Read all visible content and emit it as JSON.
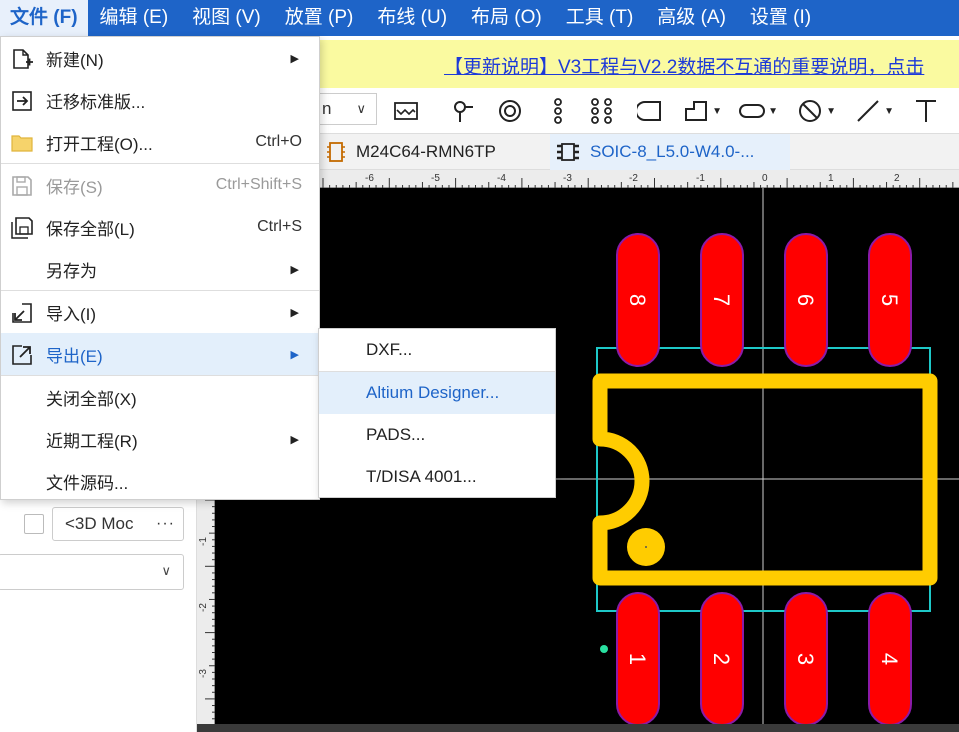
{
  "menubar": {
    "items": [
      {
        "label": "文件 (F)",
        "active": true
      },
      {
        "label": "编辑 (E)"
      },
      {
        "label": "视图 (V)"
      },
      {
        "label": "放置 (P)"
      },
      {
        "label": "布线 (U)"
      },
      {
        "label": "布局 (O)"
      },
      {
        "label": "工具 (T)"
      },
      {
        "label": "高级 (A)"
      },
      {
        "label": "设置 (I)"
      }
    ]
  },
  "notice": {
    "text": "【更新说明】V3工程与V2.2数据不互通的重要说明，点击"
  },
  "toolbar": {
    "unit_select": "n"
  },
  "tabs": [
    {
      "label": "M24C64-RMN6TP",
      "icon": "chip-icon"
    },
    {
      "label": "SOIC-8_L5.0-W4.0-...",
      "icon": "footprint-icon",
      "active": true
    }
  ],
  "file_menu": {
    "items": [
      {
        "label": "新建(N)",
        "icon": "new-file-icon",
        "submenu": true
      },
      {
        "label": "迁移标准版...",
        "icon": "migrate-icon"
      },
      {
        "label": "打开工程(O)...",
        "icon": "folder-icon",
        "shortcut": "Ctrl+O"
      },
      {
        "label": "保存(S)",
        "icon": "save-icon",
        "shortcut": "Ctrl+Shift+S",
        "disabled": true
      },
      {
        "label": "保存全部(L)",
        "icon": "save-all-icon",
        "shortcut": "Ctrl+S"
      },
      {
        "label": "另存为",
        "submenu": true
      },
      {
        "label": "导入(I)",
        "icon": "import-icon",
        "submenu": true
      },
      {
        "label": "导出(E)",
        "icon": "export-icon",
        "submenu": true,
        "highlighted": true
      },
      {
        "label": "关闭全部(X)"
      },
      {
        "label": "近期工程(R)",
        "submenu": true
      },
      {
        "label": "文件源码..."
      }
    ]
  },
  "export_submenu": {
    "items": [
      {
        "label": "DXF..."
      },
      {
        "label": "Altium Designer...",
        "highlighted": true
      },
      {
        "label": "PADS..."
      },
      {
        "label": "T/DISA 4001..."
      }
    ]
  },
  "left_panel": {
    "model_field": "<3D Moc",
    "more": "···"
  },
  "ruler": {
    "h_labels": [
      "-6",
      "-5",
      "-4",
      "-3",
      "-2",
      "-1",
      "0",
      "1",
      "2"
    ],
    "v_labels": [
      "-1",
      "-2",
      "-3"
    ]
  },
  "footprint": {
    "pins_top": [
      "8",
      "7",
      "6",
      "5"
    ],
    "pins_bottom": [
      "1",
      "2",
      "3",
      "4"
    ],
    "colors": {
      "pad": "#ff0000",
      "pad_outline": "#8b1aa8",
      "silkscreen": "#ffcc00",
      "courtyard": "#1ec8c8",
      "canvas": "#000000"
    }
  }
}
